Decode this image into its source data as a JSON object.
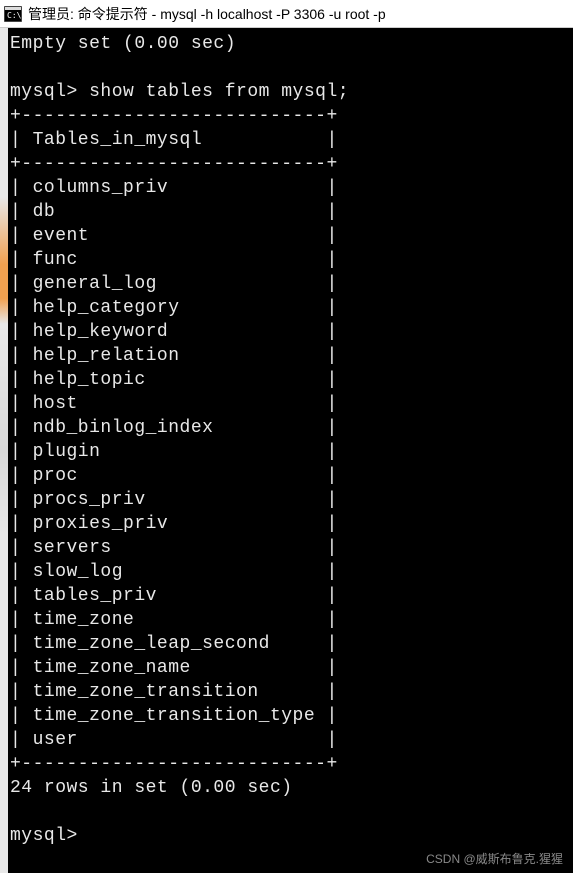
{
  "titlebar": {
    "text": "管理员: 命令提示符 - mysql  -h localhost -P 3306 -u root -p"
  },
  "terminal": {
    "empty_set": "Empty set (0.00 sec)",
    "prompt1": "mysql> show tables from mysql;",
    "border_top": "+---------------------------+",
    "header_line": "| Tables_in_mysql           |",
    "border_mid": "+---------------------------+",
    "rows": [
      "| columns_priv              |",
      "| db                        |",
      "| event                     |",
      "| func                      |",
      "| general_log               |",
      "| help_category             |",
      "| help_keyword              |",
      "| help_relation             |",
      "| help_topic                |",
      "| host                      |",
      "| ndb_binlog_index          |",
      "| plugin                    |",
      "| proc                      |",
      "| procs_priv                |",
      "| proxies_priv              |",
      "| servers                   |",
      "| slow_log                  |",
      "| tables_priv               |",
      "| time_zone                 |",
      "| time_zone_leap_second     |",
      "| time_zone_name            |",
      "| time_zone_transition      |",
      "| time_zone_transition_type |",
      "| user                      |"
    ],
    "border_bot": "+---------------------------+",
    "summary": "24 rows in set (0.00 sec)",
    "prompt2": "mysql>"
  },
  "watermark": "CSDN @威斯布鲁克.猩猩"
}
